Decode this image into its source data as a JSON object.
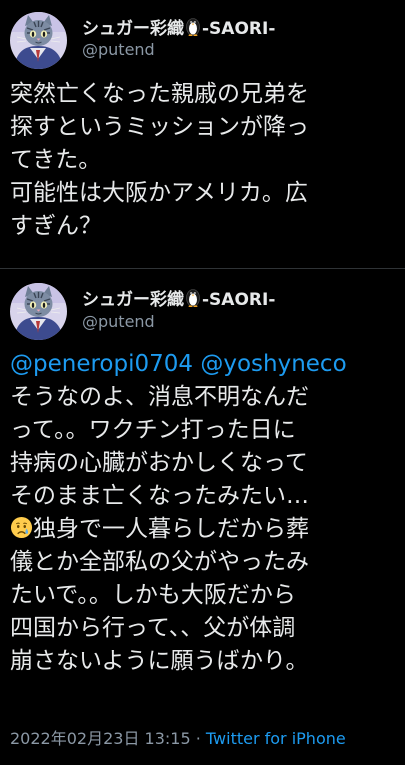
{
  "colors": {
    "background": "#000000",
    "text": "#e7e9ea",
    "secondary": "#8b98a5",
    "link": "#1d9bf0",
    "divider": "#2f3336"
  },
  "tweets": [
    {
      "author": {
        "name_prefix": "シュガー彩織",
        "name_suffix": "-SAORI-",
        "handle": "@putend",
        "name_icon": "penguin-icon",
        "avatar_icon": "cat-avatar"
      },
      "body_lines": [
        "突然亡くなった親戚の兄弟を",
        "探すというミッションが降っ",
        "てきた。",
        "可能性は大阪かアメリカ。広",
        "すぎん？"
      ]
    },
    {
      "author": {
        "name_prefix": "シュガー彩織",
        "name_suffix": "-SAORI-",
        "handle": "@putend",
        "name_icon": "penguin-icon",
        "avatar_icon": "cat-avatar"
      },
      "mentions": [
        "@peneropi0704",
        "@yoshyneco"
      ],
      "body_lines": [
        "そうなのよ、消息不明なんだ",
        "って。。ワクチン打った日に",
        "持病の心臓がおかしくなって",
        "そのまま亡くなったみたい…"
      ],
      "emoji_icon": "crying-face-icon",
      "body_after_emoji": "独身で一人暮らしだから葬",
      "body_lines_2": [
        "儀とか全部私の父がやったみ",
        "たいで。。しかも大阪だから",
        "四国から行って、、父が体調",
        "崩さないように願うばかり。"
      ],
      "timestamp": "2022年02月23日 13:15",
      "separator": " · ",
      "source": "Twitter for iPhone"
    }
  ]
}
